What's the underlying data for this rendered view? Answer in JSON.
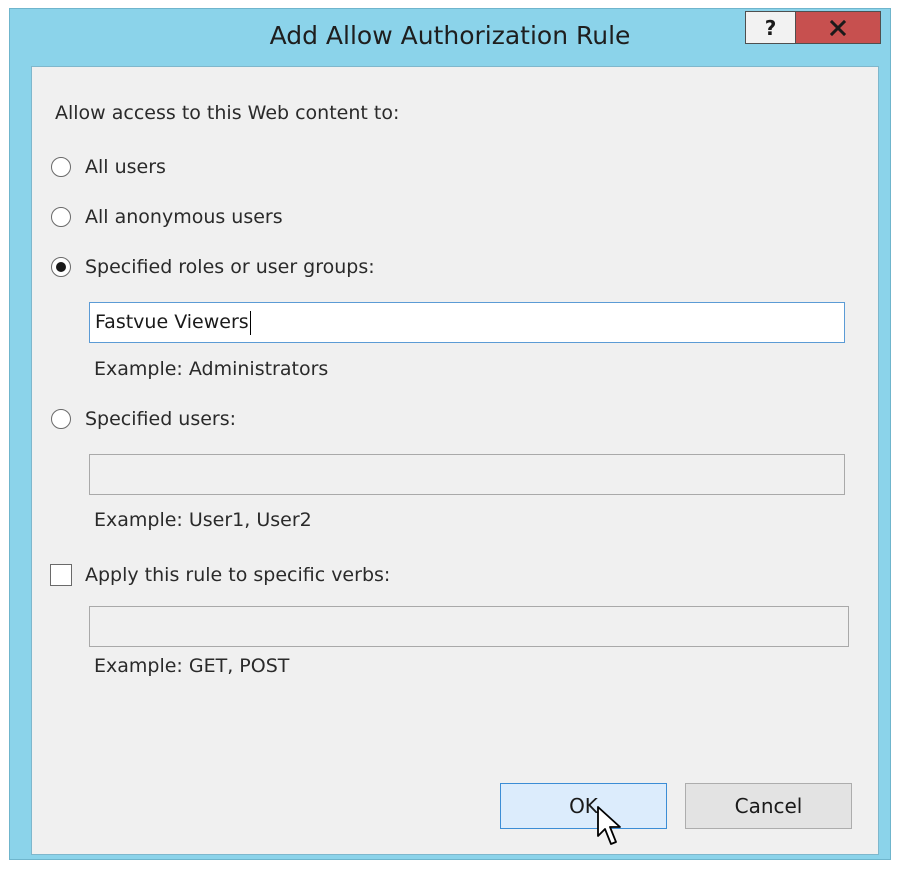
{
  "window": {
    "title": "Add Allow Authorization Rule",
    "help_label": "?",
    "close_label": "x"
  },
  "form": {
    "intro": "Allow access to this Web content to:",
    "options": [
      {
        "label": "All users",
        "selected": false
      },
      {
        "label": "All anonymous users",
        "selected": false
      },
      {
        "label": "Specified roles or user groups:",
        "selected": true
      },
      {
        "label": "Specified users:",
        "selected": false
      }
    ],
    "roles_value": "Fastvue Viewers",
    "roles_example": "Example: Administrators",
    "users_value": "",
    "users_example": "Example: User1, User2",
    "verbs_checkbox_label": "Apply this rule to specific verbs:",
    "verbs_checked": false,
    "verbs_value": "",
    "verbs_example": "Example: GET, POST"
  },
  "buttons": {
    "ok": "OK",
    "cancel": "Cancel"
  },
  "colors": {
    "frame": "#8bd3ea",
    "close": "#c7504f",
    "ok_bg": "#dcecfc",
    "ok_border": "#3c8dd5"
  },
  "icons": {
    "cursor": "mouse-pointer-icon",
    "close": "close-icon",
    "help": "help-icon"
  }
}
